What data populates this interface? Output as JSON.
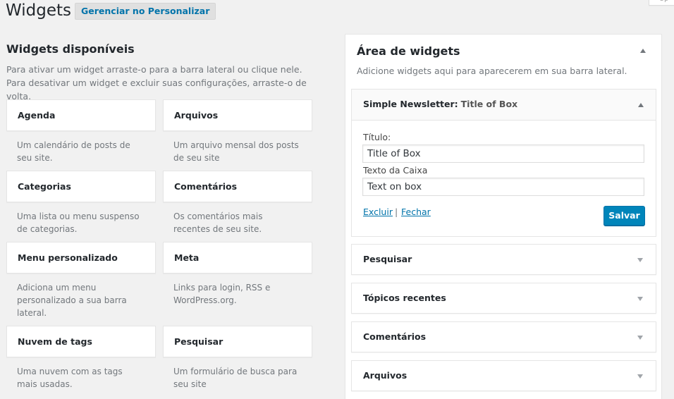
{
  "header": {
    "title": "Widgets",
    "manage_button": "Gerenciar no Personalizar",
    "corner_tab": "Op"
  },
  "available": {
    "title": "Widgets disponíveis",
    "description": "Para ativar um widget arraste-o para a barra lateral ou clique nele. Para desativar um widget e excluir suas configurações, arraste-o de volta.",
    "widgets": [
      {
        "name": "Agenda",
        "desc": "Um calendário de posts de seu site."
      },
      {
        "name": "Arquivos",
        "desc": "Um arquivo mensal dos posts de seu site"
      },
      {
        "name": "Categorias",
        "desc": "Uma lista ou menu suspenso de categorias."
      },
      {
        "name": "Comentários",
        "desc": "Os comentários mais recentes de seu site."
      },
      {
        "name": "Menu personalizado",
        "desc": "Adiciona um menu personalizado a sua barra lateral."
      },
      {
        "name": "Meta",
        "desc": "Links para login, RSS e WordPress.org."
      },
      {
        "name": "Nuvem de tags",
        "desc": "Uma nuvem com as tags mais usadas."
      },
      {
        "name": "Pesquisar",
        "desc": "Um formulário de busca para seu site"
      }
    ]
  },
  "sidebar": {
    "title": "Área de widgets",
    "description": "Adicione widgets aqui para aparecerem em sua barra lateral.",
    "open_widget": {
      "name": "Simple Newsletter",
      "separator": ":",
      "instance_title": "Title of Box",
      "title_label": "Título:",
      "title_value": "Title of Box",
      "text_label": "Texto da Caixa",
      "text_value": "Text on box",
      "delete_link": "Excluir",
      "link_separator": "|",
      "close_link": "Fechar",
      "save_button": "Salvar"
    },
    "widgets": [
      {
        "name": "Pesquisar"
      },
      {
        "name": "Tópicos recentes"
      },
      {
        "name": "Comentários"
      },
      {
        "name": "Arquivos"
      }
    ]
  },
  "colors": {
    "background": "#f1f1f1",
    "link": "#0073aa",
    "primary_button": "#0085ba"
  },
  "icons": {
    "collapse": "arrow-up-icon",
    "expand": "arrow-down-icon"
  }
}
